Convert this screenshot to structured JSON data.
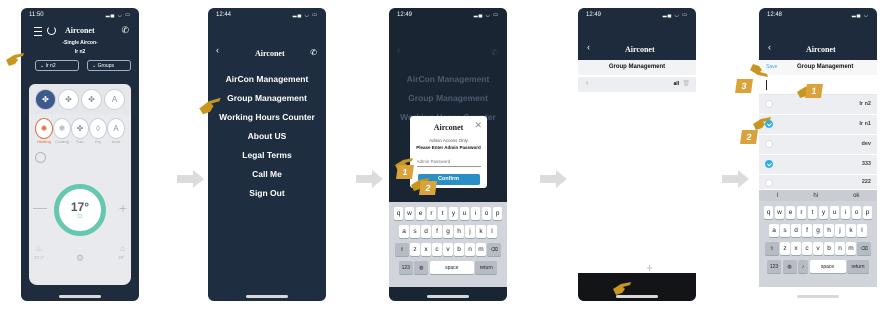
{
  "brand": "Airconet",
  "phone1": {
    "time": "11:50",
    "subtitle": "-Single Aircon-",
    "unit": "Ir n2",
    "unit_select": "Ir n2",
    "groups_select": "Groups",
    "modes": [
      "Heating",
      "Cooling",
      "Fan",
      "Dry",
      "Auto"
    ],
    "temperature": "17°",
    "left_temp": "27.2°",
    "right_temp": "28°"
  },
  "phone2": {
    "time": "12:44",
    "menu": [
      "AirCon Management",
      "Group Management",
      "Working Hours Counter",
      "About US",
      "Legal Terms",
      "Call Me",
      "Sign Out"
    ]
  },
  "phone3": {
    "time": "12:49",
    "menu": [
      "AirCon Management",
      "Group Management",
      "Working Hours Counter"
    ],
    "dialog": {
      "line1": "Admin Access Only",
      "line2": "Please Enter Admin Password",
      "placeholder": "Admin Password",
      "confirm": "Confirm"
    },
    "keyboard": {
      "row1": [
        "q",
        "w",
        "e",
        "r",
        "t",
        "y",
        "u",
        "i",
        "o",
        "p"
      ],
      "row2": [
        "a",
        "s",
        "d",
        "f",
        "g",
        "h",
        "j",
        "k",
        "l"
      ],
      "row3": [
        "z",
        "x",
        "c",
        "v",
        "b",
        "n",
        "m"
      ],
      "num": "123",
      "space": "space",
      "ret": "return"
    }
  },
  "phone4": {
    "time": "12:49",
    "title": "Group Management",
    "row_label": "all"
  },
  "phone5": {
    "time": "12:48",
    "save": "Save",
    "title": "Group Management",
    "rows": [
      {
        "name": "Ir n2",
        "checked": false
      },
      {
        "name": "Ir n1",
        "checked": true
      },
      {
        "name": "dev",
        "checked": false
      },
      {
        "name": "333",
        "checked": true
      },
      {
        "name": "222",
        "checked": false
      }
    ],
    "suggestions": [
      "I",
      "hi",
      "ok"
    ],
    "keyboard": {
      "row1": [
        "q",
        "w",
        "e",
        "r",
        "t",
        "y",
        "u",
        "i",
        "o",
        "p"
      ],
      "row2": [
        "a",
        "s",
        "d",
        "f",
        "g",
        "h",
        "j",
        "k",
        "l"
      ],
      "row3": [
        "z",
        "x",
        "c",
        "v",
        "b",
        "n",
        "m"
      ],
      "num": "123",
      "space": "space",
      "ret": "return"
    }
  },
  "badges": {
    "one": "1",
    "two": "2",
    "three": "3"
  },
  "colors": {
    "accent": "#2ab0e6",
    "badge": "#d9a23a",
    "dial": "#66c8b1",
    "hand": "#c8961e"
  }
}
